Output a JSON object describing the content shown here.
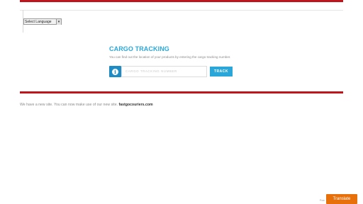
{
  "language_selector": {
    "label": "Select Language",
    "arrow": "▾"
  },
  "tracking": {
    "title": "CARGO TRACKING",
    "description": "You can find out the location of your products by entering the cargo tracking number.",
    "input_placeholder": "CARGO TRACKING NUMBER",
    "button_label": "TRACK",
    "info_icon": "info-icon"
  },
  "notice": {
    "text": "We have a new site. You can now make use of our new site.",
    "link_text": "fastgocouriers.com"
  },
  "footer": {
    "powered_text": "Pow",
    "translate_label": "Translate"
  },
  "colors": {
    "accent_red": "#c0151c",
    "accent_blue": "#2aa7d8",
    "icon_blue": "#1d8cc4",
    "translate_orange": "#e8700a"
  }
}
